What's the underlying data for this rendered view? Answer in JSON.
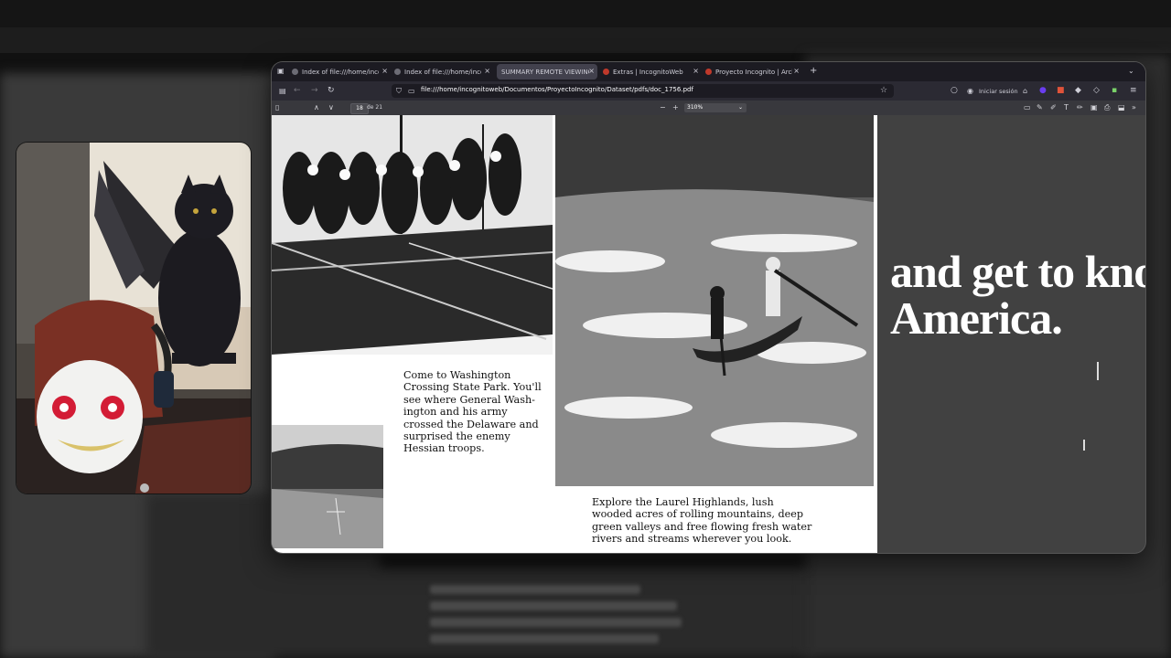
{
  "tabs": [
    {
      "label": "Index of file:///home/incognitoweb/",
      "active": false
    },
    {
      "label": "Index of file:///home/incognitoweb/",
      "active": false
    },
    {
      "label": "SUMMARY REMOTE VIEWING S",
      "active": true
    },
    {
      "label": "Extras | IncognitoWeb",
      "active": false
    },
    {
      "label": "Proyecto Incognito | Archivos",
      "active": false
    }
  ],
  "tab_close": "×",
  "new_tab": "+",
  "url": "file:///home/incognitoweb/Documentos/ProyectoIncognito/Dataset/pdfs/doc_1756.pdf",
  "signin_label": "Iniciar sesión",
  "pdf_toolbar": {
    "current_page": "18",
    "page_total": "de 21",
    "zoom": "310%",
    "zoom_out": "−",
    "zoom_in": "+"
  },
  "document": {
    "caption_washington": "Come to Washington\nCrossing State Park. You'll\nsee where General Wash-\nington and his army\ncrossed the Delaware and\nsurprised the enemy\nHessian troops.",
    "caption_laurel": "Explore the Laurel Highlands, lush\nwooded acres of rolling mountains, deep\ngreen valleys and free flowing fresh water\nrivers and streams wherever you look.",
    "headline": "and get to kno\nAmerica."
  },
  "colors": {
    "tab_bar": "#1c1b22",
    "nav_bar": "#2b2a33",
    "pdf_toolbar": "#38383d",
    "active_tab": "#42414d"
  }
}
